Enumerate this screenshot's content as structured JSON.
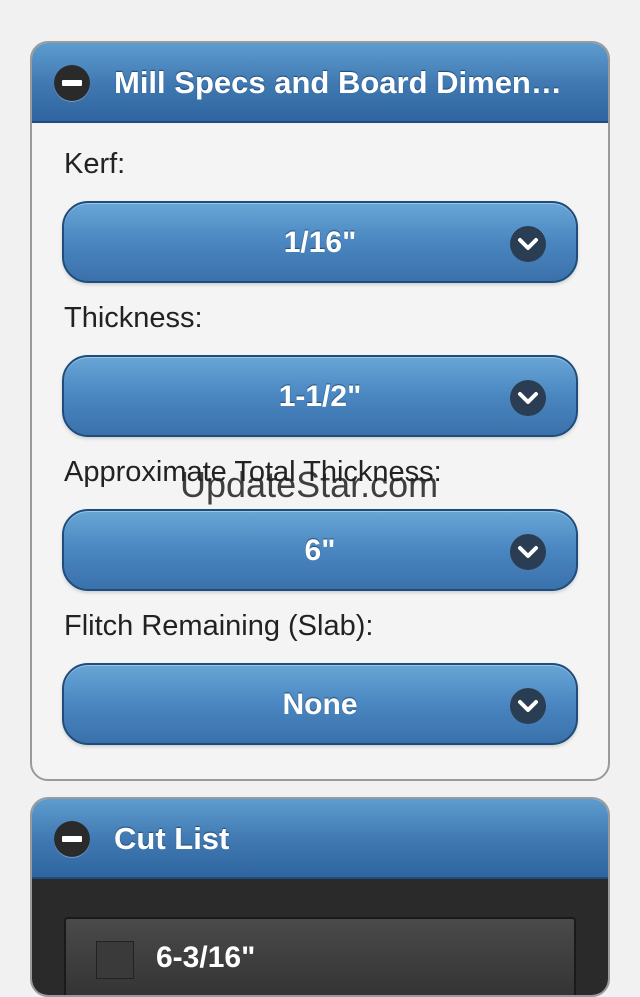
{
  "mill_specs": {
    "title": "Mill Specs and Board Dimen…",
    "fields": [
      {
        "label": "Kerf:",
        "value": "1/16\""
      },
      {
        "label": "Thickness:",
        "value": "1-1/2\""
      },
      {
        "label": "Approximate Total Thickness:",
        "value": "6\""
      },
      {
        "label": "Flitch Remaining (Slab):",
        "value": "None"
      }
    ]
  },
  "cut_list": {
    "title": "Cut List",
    "items": [
      {
        "value": "6-3/16\""
      }
    ]
  },
  "watermark": "UpdateStar.com",
  "colors": {
    "header_blue": "#3f77b0",
    "button_blue": "#4a86c0",
    "dark_body": "#2a2a2a"
  },
  "icons": {
    "collapse": "minus-circle-icon",
    "dropdown": "chevron-down-icon"
  }
}
